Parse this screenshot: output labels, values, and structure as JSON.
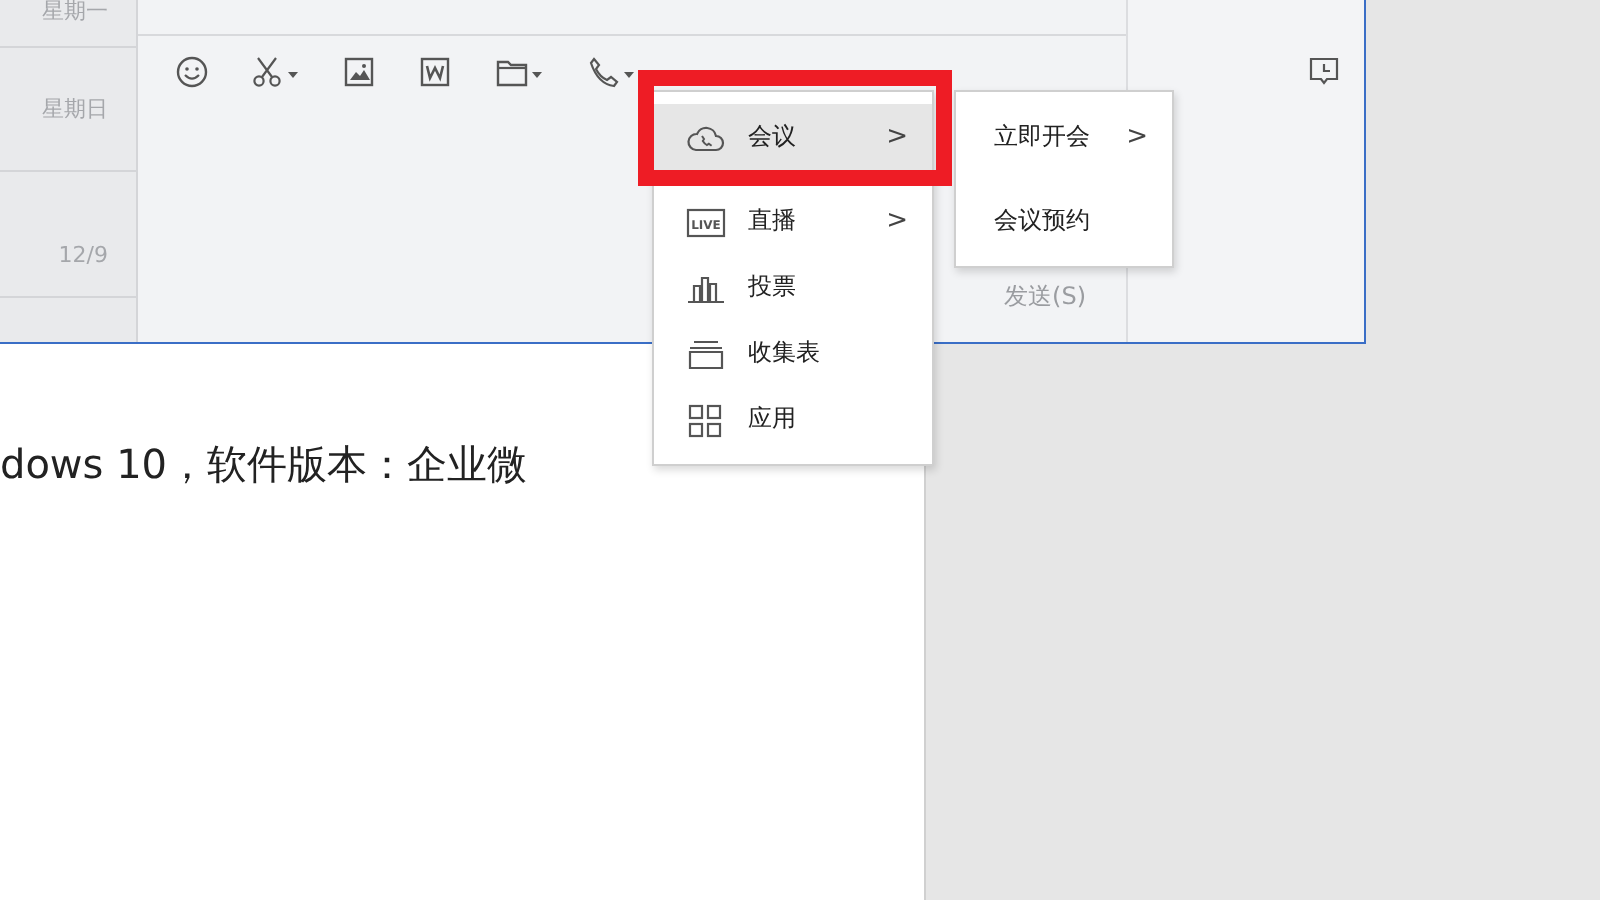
{
  "document": {
    "paragraph": "dows 10，软件版本：企业微"
  },
  "chat_window": {
    "dates": [
      "星期一",
      "星期日",
      "12/9"
    ],
    "toolbar": [
      {
        "dropdown": false
      },
      {
        "dropdown": true
      },
      {
        "dropdown": false
      },
      {
        "dropdown": false
      },
      {
        "dropdown": true
      },
      {
        "dropdown": true
      }
    ],
    "send_button": "发送(S)"
  },
  "menu": {
    "items": [
      {
        "label": "会议",
        "arrow": ">",
        "selected": true
      },
      {
        "label": "直播",
        "arrow": ">",
        "icon_text": "LIVE",
        "selected": false
      },
      {
        "label": "投票",
        "selected": false
      },
      {
        "label": "收集表",
        "selected": false
      },
      {
        "label": "应用",
        "selected": false
      }
    ]
  },
  "submenu": {
    "items": [
      {
        "label": "立即开会",
        "arrow": ">",
        "selected": false
      },
      {
        "label": "会议预约",
        "selected": false
      }
    ]
  }
}
